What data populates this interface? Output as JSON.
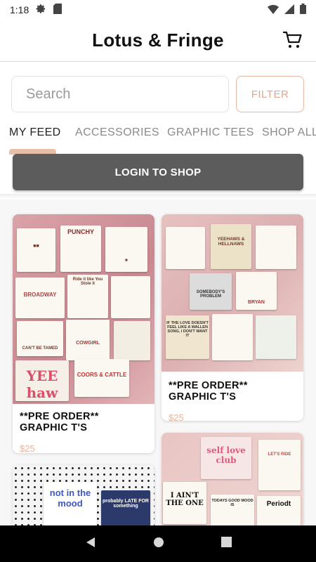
{
  "status_bar": {
    "time": "1:18"
  },
  "header": {
    "title": "Lotus & Fringe"
  },
  "search": {
    "placeholder": "Search",
    "filter_label": "FILTER"
  },
  "tabs": [
    {
      "label": "MY FEED"
    },
    {
      "label": "ACCESSORIES"
    },
    {
      "label": "GRAPHIC TEES"
    },
    {
      "label": "SHOP ALL"
    }
  ],
  "login": {
    "label": "LOGIN TO SHOP"
  },
  "products": [
    {
      "title": "**PRE ORDER** GRAPHIC T'S",
      "price": "$25",
      "image_text": [
        "PUNCHY",
        "BROADWAY",
        "Ride it like You Stole it",
        "CAN'T BE TAMED",
        "COWGIRL",
        "YEE haw",
        "COORS & CATTLE"
      ]
    },
    {
      "title": "**PRE ORDER** GRAPHIC T'S",
      "price": "$25",
      "image_text": [
        "YEEHAWS & HELLNAWS",
        "SOMEBODY'S PROBLEM",
        "IF THE LOVE DOESN'T FEEL LIKE A WALLEN SONG, I DON'T WANT IT",
        "BRYAN"
      ]
    },
    {
      "title": "",
      "price": "",
      "image_text": [
        "not in the mood",
        "probably LATE FOR something"
      ]
    },
    {
      "title": "",
      "price": "",
      "image_text": [
        "self love club",
        "LET'S RIDE",
        "I AIN'T THE ONE",
        "TODAYS GOOD MOOD IS",
        "Periodt"
      ]
    }
  ],
  "colors": {
    "accent": "#e0a78c",
    "login_bg": "#5c5c5c",
    "price": "#e8b49b"
  }
}
